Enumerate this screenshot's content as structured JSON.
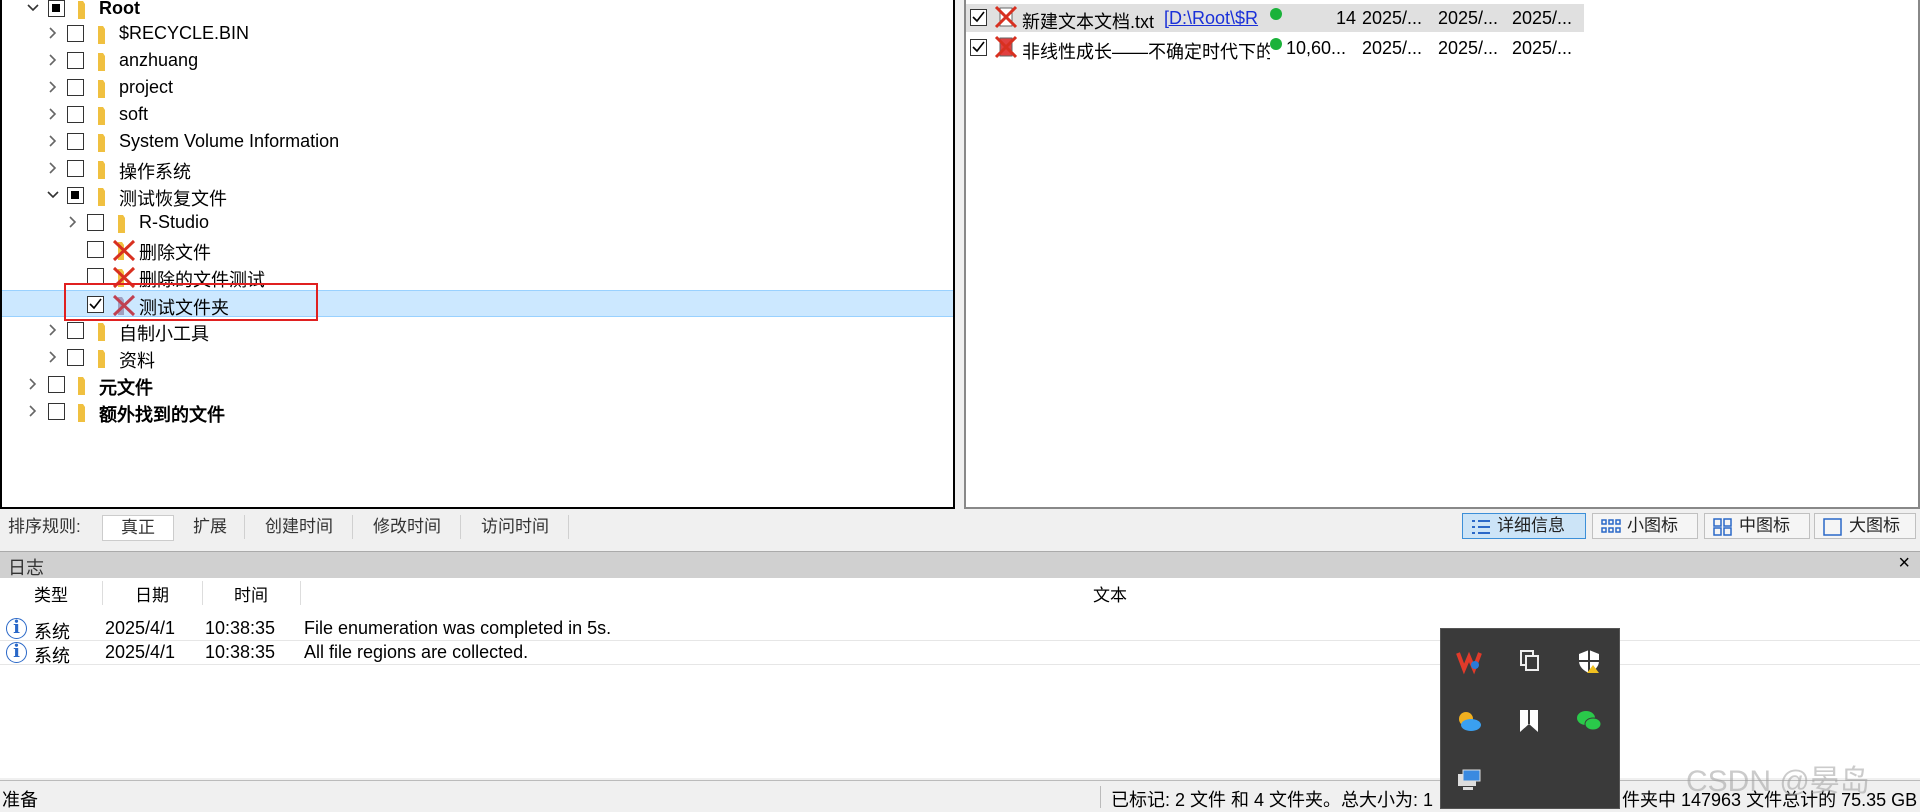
{
  "tree": {
    "items": [
      {
        "label": "Root",
        "bold": true
      },
      {
        "label": "$RECYCLE.BIN"
      },
      {
        "label": "anzhuang"
      },
      {
        "label": "project"
      },
      {
        "label": "soft"
      },
      {
        "label": "System Volume Information"
      },
      {
        "label": "操作系统"
      },
      {
        "label": "测试恢复文件"
      },
      {
        "label": "R-Studio"
      },
      {
        "label": "删除文件"
      },
      {
        "label": "删除的文件测试"
      },
      {
        "label": "测试文件夹"
      },
      {
        "label": "自制小工具"
      },
      {
        "label": "资料"
      },
      {
        "label": "元文件",
        "bold": true
      },
      {
        "label": "额外找到的文件",
        "bold": true
      }
    ]
  },
  "file_list": {
    "rows": [
      {
        "name": "新建文本文档.txt",
        "path": "[D:\\Root\\$R",
        "size": "14",
        "created": "2025/...",
        "modified": "2025/...",
        "accessed": "2025/..."
      },
      {
        "name": "非线性成长——不确定时代下的",
        "path": "",
        "size": "10,60...",
        "created": "2025/...",
        "modified": "2025/...",
        "accessed": "2025/..."
      }
    ]
  },
  "sort_bar": {
    "label": "排序规则:",
    "options": [
      "真正",
      "扩展",
      "创建时间",
      "修改时间",
      "访问时间"
    ],
    "views": [
      "详细信息",
      "小图标",
      "中图标",
      "大图标"
    ]
  },
  "log": {
    "title": "日志",
    "close": "×",
    "columns": [
      "类型",
      "日期",
      "时间",
      "文本"
    ],
    "rows": [
      {
        "type": "系统",
        "date": "2025/4/1",
        "time": "10:38:35",
        "text": "File enumeration was completed in 5s."
      },
      {
        "type": "系统",
        "date": "2025/4/1",
        "time": "10:38:35",
        "text": "All file regions are collected."
      }
    ]
  },
  "status": {
    "left": "准备",
    "marked": "已标记: 2 文件 和 4 文件夹。总大小为: 1",
    "right": "件夹中 147963 文件总计的 75.35 GB"
  },
  "watermark": "CSDN @晏岛",
  "colors": {
    "selection": "#cce8ff",
    "highlight_box": "#e02020",
    "status_dot": "#1ab23a",
    "link": "#1a30d8"
  }
}
